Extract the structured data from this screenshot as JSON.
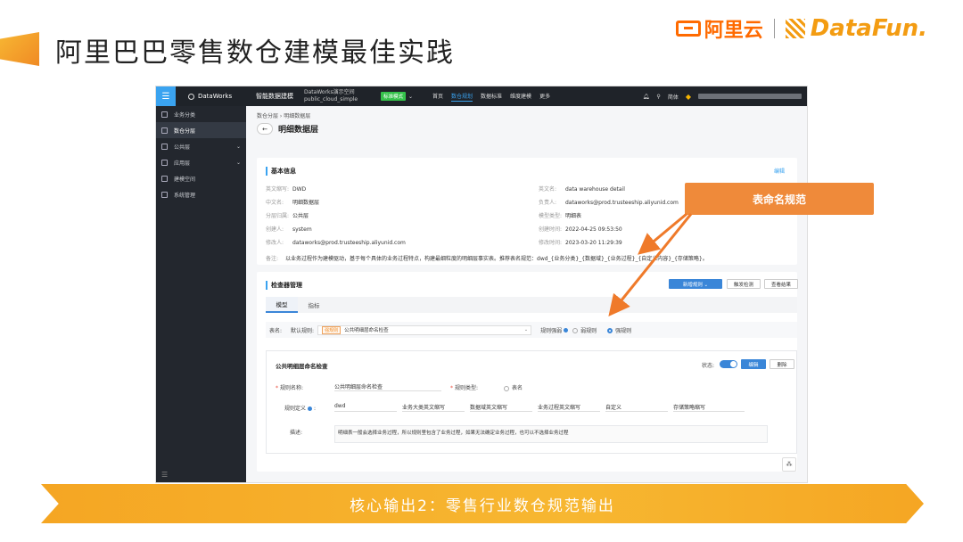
{
  "slide": {
    "title": "阿里巴巴零售数仓建模最佳实践",
    "logo_aliyun": "阿里云",
    "logo_datafun": "DataFun.",
    "callout": "表命名规范",
    "banner": "核心输出2：零售行业数仓规范输出"
  },
  "topbar": {
    "brand": "DataWorks",
    "product": "智能数据建模",
    "workspace_line1": "DataWorks演示空间",
    "workspace_line2": "public_cloud_simple",
    "mode": "标准模式",
    "nav": [
      "首页",
      "数仓规划",
      "数据标准",
      "维度建模",
      "更多"
    ],
    "lang": "简体"
  },
  "sidebar": {
    "items": [
      {
        "label": "业务分类"
      },
      {
        "label": "数仓分层"
      },
      {
        "label": "公共层"
      },
      {
        "label": "应用层"
      },
      {
        "label": "建模空间"
      },
      {
        "label": "系统管理"
      }
    ],
    "collapse": "☰"
  },
  "page": {
    "breadcrumb": "数仓分层 › 明细数据层",
    "title": "明细数据层",
    "back": "←"
  },
  "basic": {
    "title": "基本信息",
    "edit": "编辑",
    "left": [
      {
        "k": "英文缩写:",
        "v": "DWD"
      },
      {
        "k": "中文名:",
        "v": "明细数据层"
      },
      {
        "k": "分层归属:",
        "v": "公共层"
      },
      {
        "k": "创建人:",
        "v": "system"
      },
      {
        "k": "修改人:",
        "v": "dataworks@prod.trusteeship.aliyunid.com"
      }
    ],
    "right": [
      {
        "k": "英文名:",
        "v": "data warehouse detail"
      },
      {
        "k": "负责人:",
        "v": "dataworks@prod.trusteeship.aliyunid.com"
      },
      {
        "k": "模型类型:",
        "v": "明细表"
      },
      {
        "k": "创建时间:",
        "v": "2022-04-25 09:53:50"
      },
      {
        "k": "修改时间:",
        "v": "2023-03-20 11:29:39"
      }
    ],
    "note_k": "备注:",
    "note_v": "以业务过程作为建模驱动，基于每个具体的业务过程特点，构建最细粒度的明细层事实表。推荐表名规范：dwd_{业务分类}_{数据域}_{业务过程}_{自定义内容}_{存储策略}。"
  },
  "checker": {
    "title": "检查器管理",
    "new_rule": "新增规则 ⌄",
    "trigger": "触发检测",
    "view_result": "查看结果",
    "tabs": [
      "模型",
      "指标"
    ],
    "filter_label": "表名:",
    "default_rule": "默认规则:",
    "tag": "强规则",
    "rule_select": "公共明细层命名检查",
    "strength_label": "规则强弱",
    "weak": "弱规则",
    "strong": "强规则"
  },
  "rule": {
    "title": "公共明细层命名检查",
    "status": "状态:",
    "edit": "编辑",
    "delete": "删除",
    "name_label": "规则名称:",
    "name_value": "公共明细层命名检查",
    "type_label": "规则类型:",
    "type_value": "表名",
    "def_label": "规则定义",
    "def_parts": [
      "dwd",
      "业务大类英文缩写",
      "数据域英文缩写",
      "业务过程英文缩写",
      "自定义",
      "存储策略缩写"
    ],
    "desc_label": "描述:",
    "desc_value": "明细表一般会选择业务过程，所以规则里包含了业务过程，如果无法确定业务过程，也可以不选择业务过程"
  }
}
